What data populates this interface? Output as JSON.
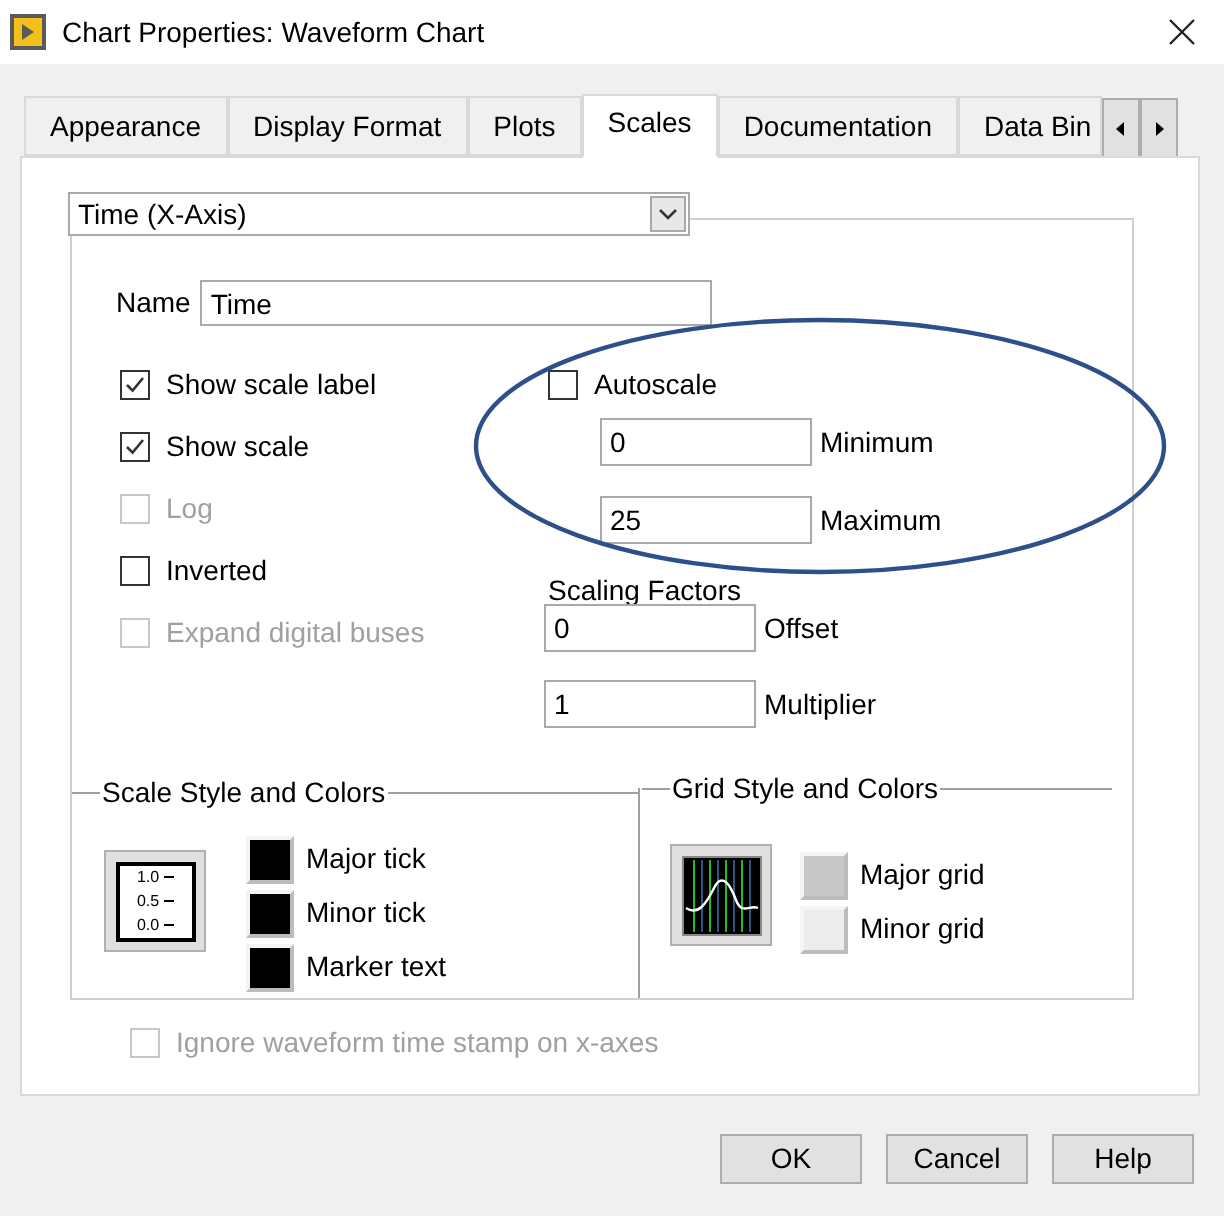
{
  "window": {
    "title": "Chart Properties: Waveform Chart"
  },
  "tabs": [
    {
      "label": "Appearance",
      "selected": false
    },
    {
      "label": "Display Format",
      "selected": false
    },
    {
      "label": "Plots",
      "selected": false
    },
    {
      "label": "Scales",
      "selected": true
    },
    {
      "label": "Documentation",
      "selected": false
    },
    {
      "label": "Data Bin",
      "selected": false
    }
  ],
  "axis_dropdown": {
    "value": "Time (X-Axis)"
  },
  "name_field": {
    "label": "Name",
    "value": "Time"
  },
  "options": [
    {
      "label": "Show scale label",
      "checked": true,
      "disabled": false
    },
    {
      "label": "Show scale",
      "checked": true,
      "disabled": false
    },
    {
      "label": "Log",
      "checked": false,
      "disabled": true
    },
    {
      "label": "Inverted",
      "checked": false,
      "disabled": false
    },
    {
      "label": "Expand digital buses",
      "checked": false,
      "disabled": true
    }
  ],
  "autoscale": {
    "label": "Autoscale",
    "checked": false
  },
  "range_fields": [
    {
      "label": "Minimum",
      "value": "0"
    },
    {
      "label": "Maximum",
      "value": "25"
    }
  ],
  "scaling_factors": {
    "title": "Scaling Factors",
    "fields": [
      {
        "label": "Offset",
        "value": "0"
      },
      {
        "label": "Multiplier",
        "value": "1"
      }
    ]
  },
  "scale_style": {
    "title": "Scale Style and Colors",
    "preview_labels": [
      "1.0",
      "0.5",
      "0.0"
    ],
    "colors": [
      {
        "label": "Major tick",
        "color": "#000000"
      },
      {
        "label": "Minor tick",
        "color": "#000000"
      },
      {
        "label": "Marker text",
        "color": "#000000"
      }
    ]
  },
  "grid_style": {
    "title": "Grid Style and Colors",
    "colors": [
      {
        "label": "Major grid",
        "color": "#c8c8c8"
      },
      {
        "label": "Minor grid",
        "color": "#ececec"
      }
    ]
  },
  "ignore_timestamp": {
    "label": "Ignore waveform time stamp on x-axes",
    "checked": false,
    "disabled": true
  },
  "buttons": [
    "OK",
    "Cancel",
    "Help"
  ]
}
